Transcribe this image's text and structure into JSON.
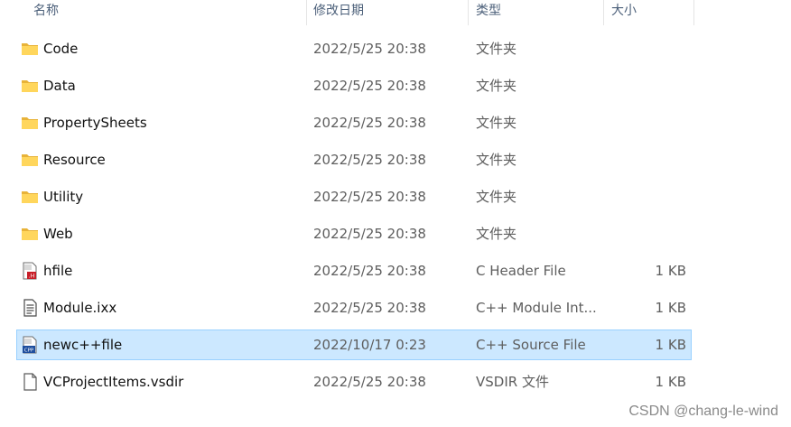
{
  "header": {
    "name_label": "名称",
    "date_label": "修改日期",
    "type_label": "类型",
    "size_label": "大小"
  },
  "files": [
    {
      "name": "Code",
      "date": "2022/5/25 20:38",
      "type": "文件夹",
      "size": "",
      "icon": "folder-icon"
    },
    {
      "name": "Data",
      "date": "2022/5/25 20:38",
      "type": "文件夹",
      "size": "",
      "icon": "folder-icon"
    },
    {
      "name": "PropertySheets",
      "date": "2022/5/25 20:38",
      "type": "文件夹",
      "size": "",
      "icon": "folder-icon"
    },
    {
      "name": "Resource",
      "date": "2022/5/25 20:38",
      "type": "文件夹",
      "size": "",
      "icon": "folder-icon"
    },
    {
      "name": "Utility",
      "date": "2022/5/25 20:38",
      "type": "文件夹",
      "size": "",
      "icon": "folder-icon"
    },
    {
      "name": "Web",
      "date": "2022/5/25 20:38",
      "type": "文件夹",
      "size": "",
      "icon": "folder-icon"
    },
    {
      "name": "hfile",
      "date": "2022/5/25 20:38",
      "type": "C Header File",
      "size": "1 KB",
      "icon": "c-header-file-icon"
    },
    {
      "name": "Module.ixx",
      "date": "2022/5/25 20:38",
      "type": "C++ Module Int...",
      "size": "1 KB",
      "icon": "module-file-icon"
    },
    {
      "name": "newc++file",
      "date": "2022/10/17 0:23",
      "type": "C++ Source File",
      "size": "1 KB",
      "icon": "cpp-source-file-icon",
      "selected": true
    },
    {
      "name": "VCProjectItems.vsdir",
      "date": "2022/5/25 20:38",
      "type": "VSDIR 文件",
      "size": "1 KB",
      "icon": "blank-file-icon"
    }
  ],
  "watermark": "CSDN @chang-le-wind",
  "colors": {
    "selection_bg": "#cce8ff",
    "selection_border": "#99d1ff",
    "folder": "#f5c84c",
    "header_text": "#4c607a"
  }
}
